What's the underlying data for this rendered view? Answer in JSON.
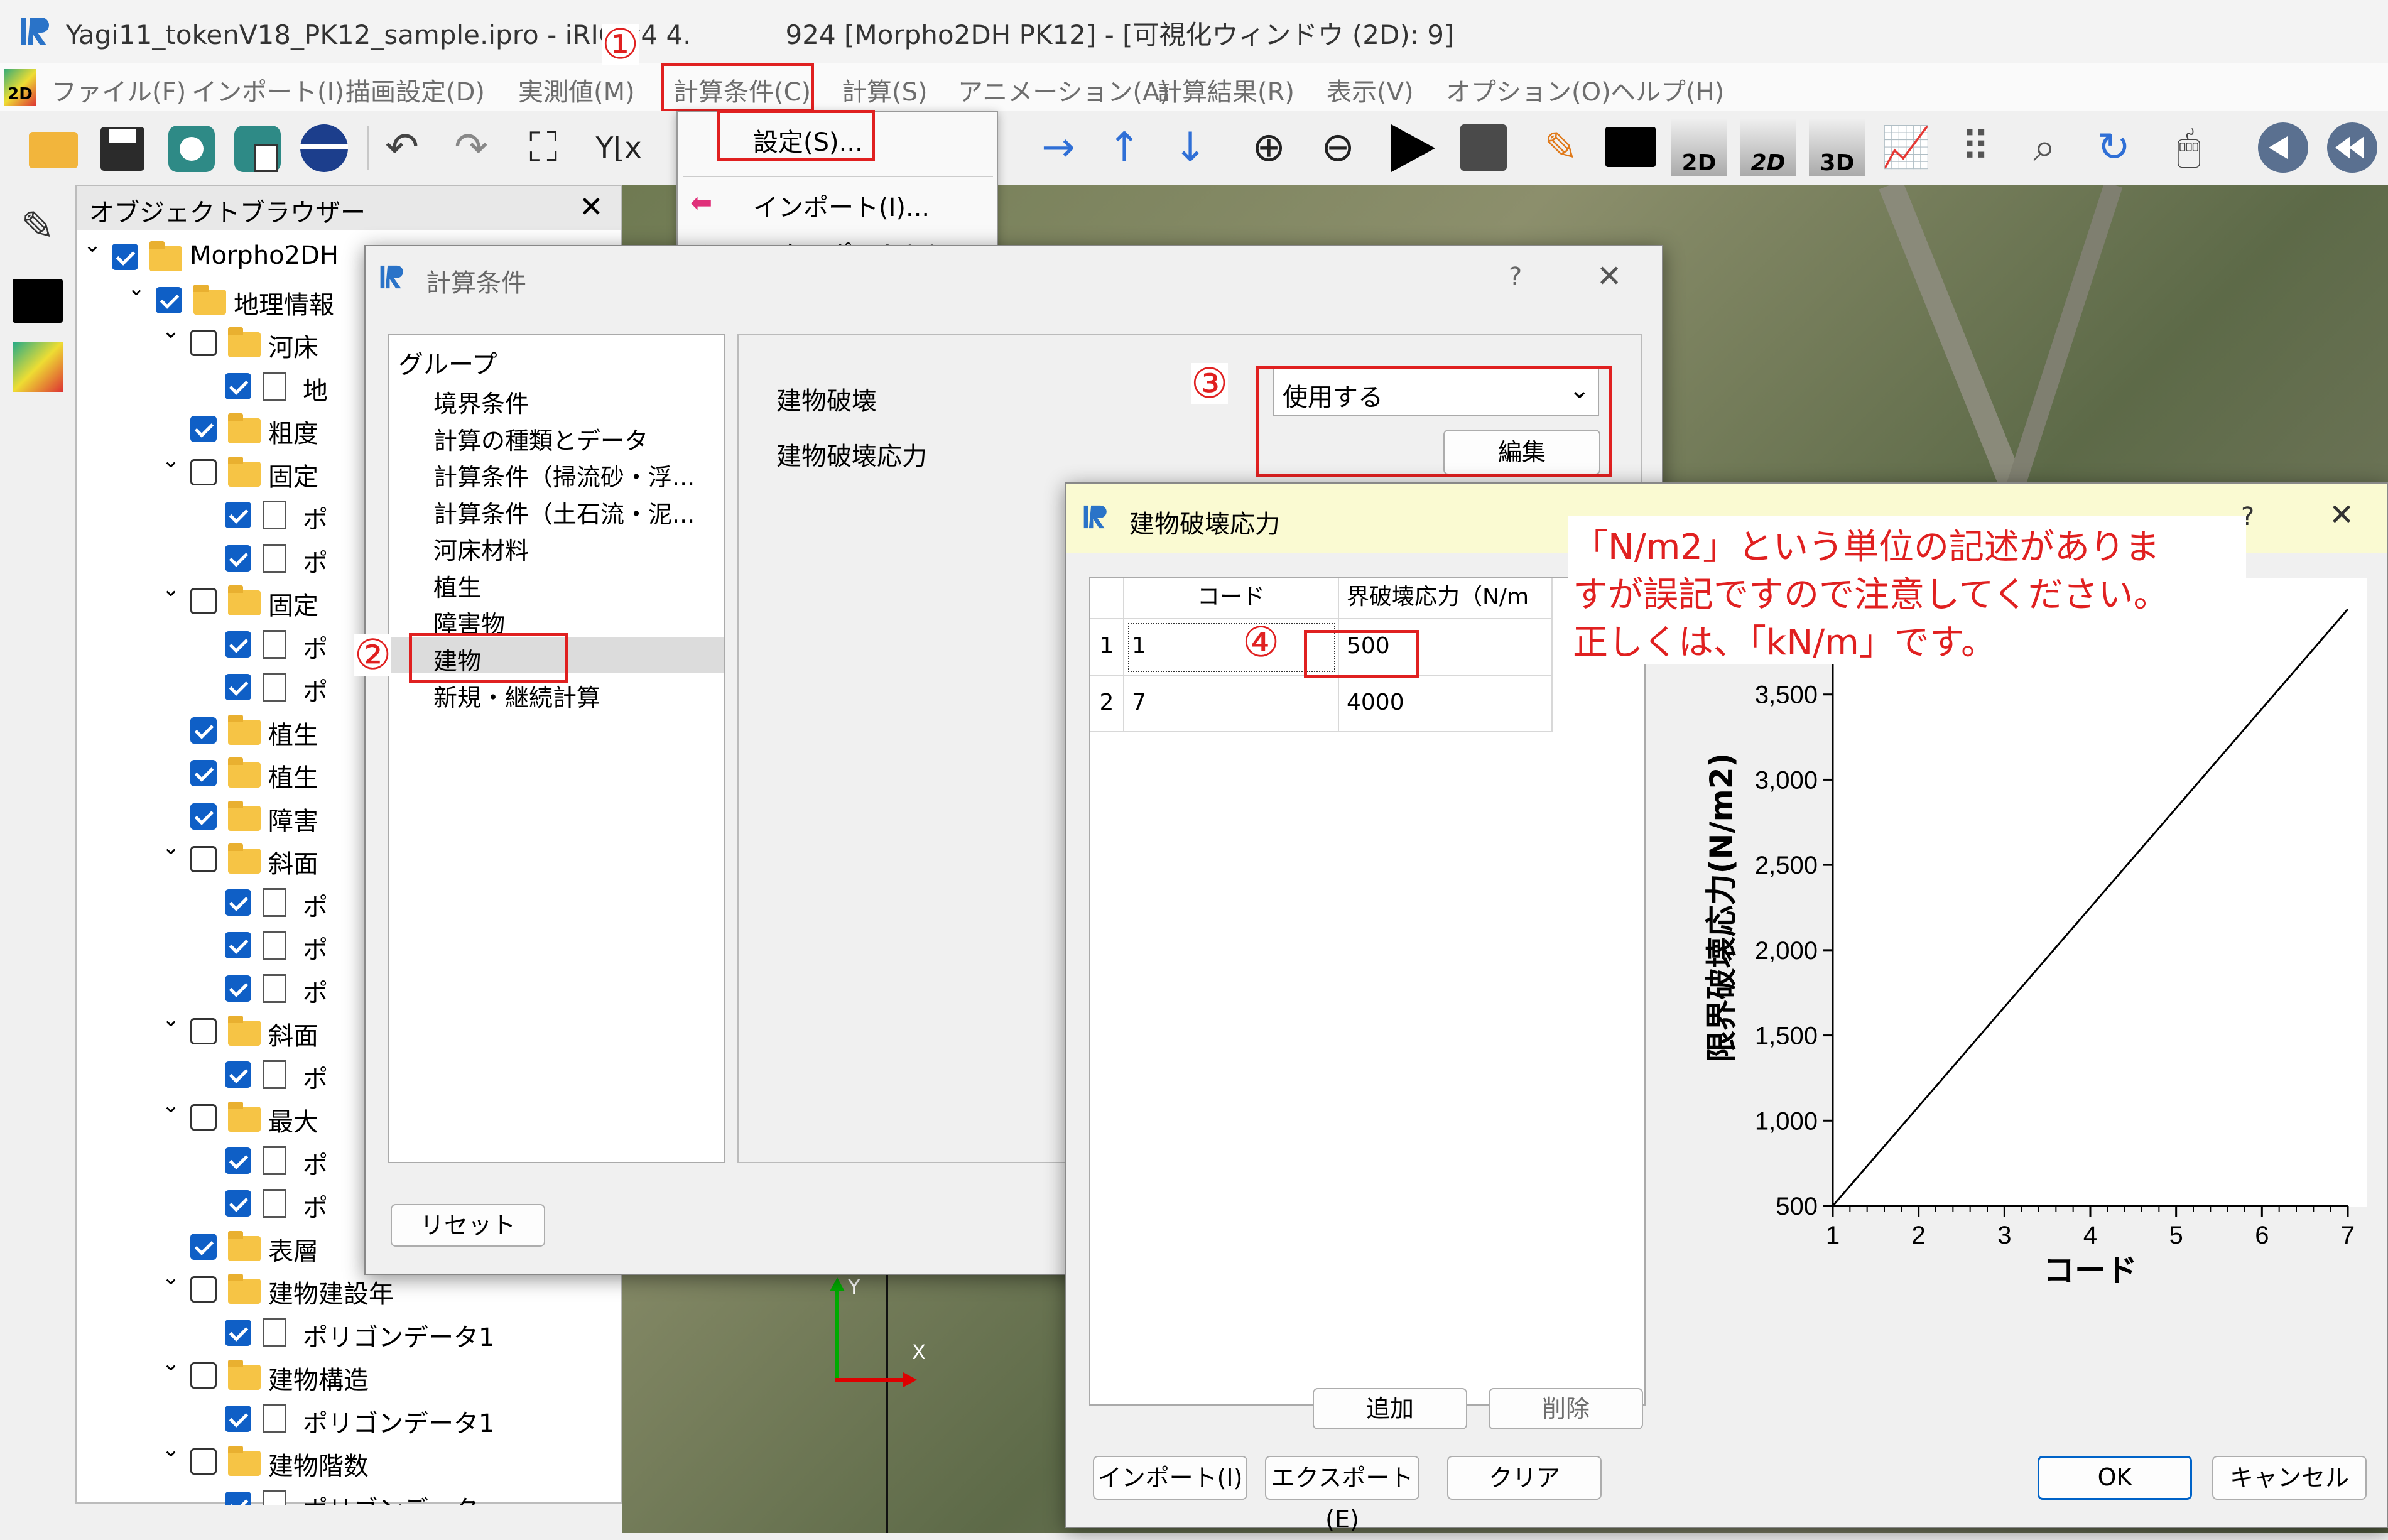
{
  "window": {
    "title": "Yagi11_tokenV18_PK12_sample.ipro - iRIC v4 4.",
    "title_rest": "924 [Morpho2DH PK12] - [可視化ウィンドウ (2D): 9]"
  },
  "menu": {
    "file": "ファイル(F)",
    "import": "インポート(I)",
    "draw": "描画設定(D)",
    "measured": "実測値(M)",
    "calc_cond": "計算条件(C)",
    "calc": "計算(S)",
    "anim": "アニメーション(A)",
    "result": "計算結果(R)",
    "view": "表示(V)",
    "option": "オプション(O)",
    "help": "ヘルプ(H)"
  },
  "dropdown": {
    "settings": "設定(S)...",
    "import": "インポート(I)...",
    "export": "エクスポート(E)..."
  },
  "toolbar": {
    "label_2d": "2D",
    "label_2d_b": "2D",
    "label_3d": "3D"
  },
  "object_browser": {
    "title": "オブジェクトブラウザー",
    "rows": [
      {
        "label": "Morpho2DH"
      },
      {
        "label": "地理情報"
      },
      {
        "label": "河床"
      },
      {
        "label": "地"
      },
      {
        "label": "粗度"
      },
      {
        "label": "固定"
      },
      {
        "label": "ポ"
      },
      {
        "label": "ポ"
      },
      {
        "label": "固定"
      },
      {
        "label": "ポ"
      },
      {
        "label": "ポ"
      },
      {
        "label": "植生"
      },
      {
        "label": "植生"
      },
      {
        "label": "障害"
      },
      {
        "label": "斜面"
      },
      {
        "label": "ポ"
      },
      {
        "label": "ポ"
      },
      {
        "label": "ポ"
      },
      {
        "label": "斜面"
      },
      {
        "label": "ポ"
      },
      {
        "label": "最大"
      },
      {
        "label": "ポ"
      },
      {
        "label": "ポ"
      },
      {
        "label": "表層"
      },
      {
        "label": "建物建設年"
      },
      {
        "label": "ポリゴンデータ1"
      },
      {
        "label": "建物構造"
      },
      {
        "label": "ポリゴンデータ1"
      },
      {
        "label": "建物階数"
      },
      {
        "label": "ポリゴンデータ"
      }
    ]
  },
  "calc_dialog": {
    "title": "計算条件",
    "help": "?",
    "group_header": "グループ",
    "groups": [
      "境界条件",
      "計算の種類とデータ",
      "計算条件（掃流砂・浮...",
      "計算条件（土石流・泥...",
      "河床材料",
      "植生",
      "障害物",
      "建物",
      "新規・継続計算"
    ],
    "building_destruction_label": "建物破壊",
    "building_destruction_value": "使用する",
    "stress_label": "建物破壊応力",
    "edit_button": "編集",
    "reset_button": "リセット"
  },
  "stress_dialog": {
    "title": "建物破壊応力",
    "help": "?",
    "table": {
      "headers": [
        "コード",
        "界破壊応力（N/m"
      ],
      "rows": [
        {
          "num": "1",
          "code": "1",
          "value": "500"
        },
        {
          "num": "2",
          "code": "7",
          "value": "4000"
        }
      ]
    },
    "add_button": "追加",
    "delete_button": "削除",
    "import_button": "インポート(I)",
    "export_button": "エクスポート(E)",
    "clear_button": "クリア",
    "ok_button": "OK",
    "cancel_button": "キャンセル"
  },
  "chart_data": {
    "type": "line",
    "x": [
      1,
      7
    ],
    "y": [
      500,
      4000
    ],
    "xlabel": "コード",
    "ylabel": "限界破壊応力(N/m2)",
    "xticks": [
      "1",
      "2",
      "3",
      "4",
      "5",
      "6",
      "7"
    ],
    "yticks": [
      "500",
      "1,000",
      "1,500",
      "2,000",
      "2,500",
      "3,000",
      "3,500"
    ],
    "xlim": [
      1,
      7
    ],
    "ylim": [
      500,
      4000
    ],
    "line_color": "#000000"
  },
  "annotation": {
    "lines": [
      "「N/m2」という単位の記述がありま",
      "すが誤記ですので注意してください。",
      "正しくは、「kN/m」です。"
    ],
    "color": "#e02020"
  },
  "markers": [
    "①",
    "②",
    "③",
    "④"
  ],
  "axis_labels": {
    "y": "Y",
    "x": "X"
  }
}
